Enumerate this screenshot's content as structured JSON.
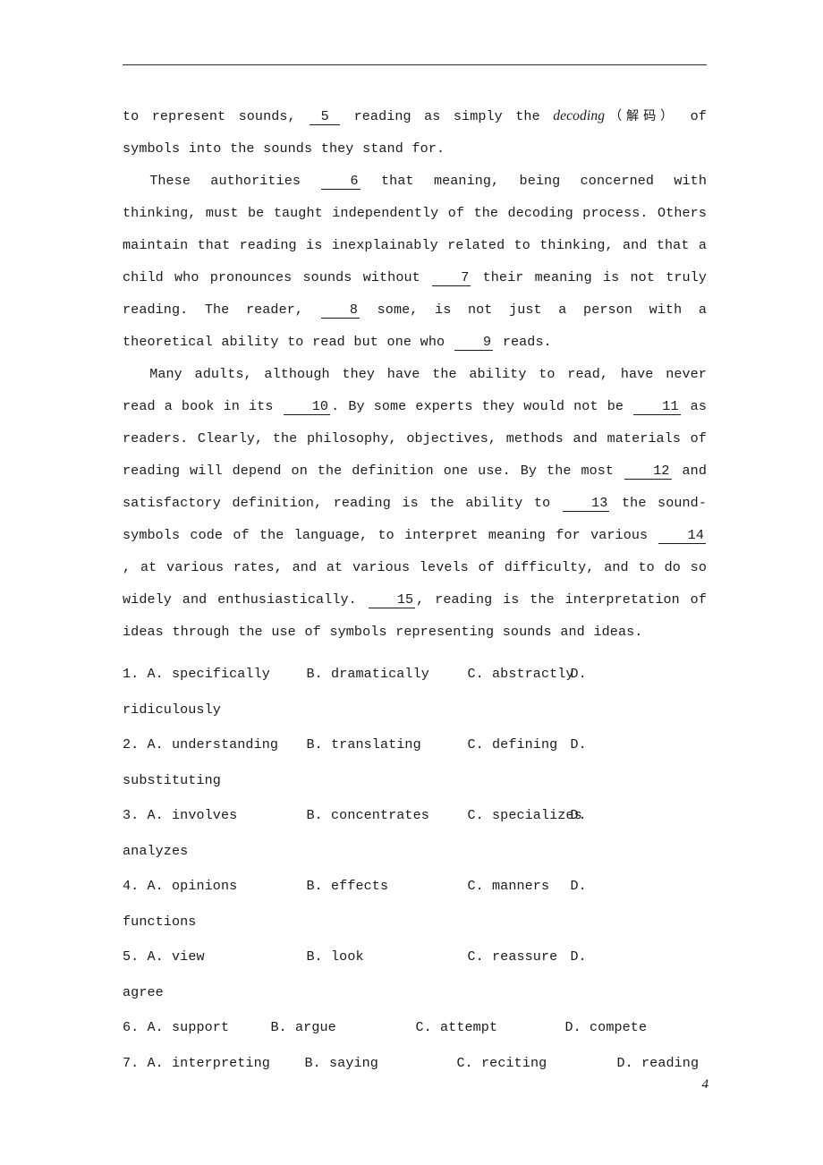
{
  "document": {
    "page_number": "4",
    "header_rule": true,
    "paragraphs": [
      {
        "id": "p-continued",
        "indent": false,
        "segments": [
          {
            "type": "text",
            "value": "to represent sounds, "
          },
          {
            "type": "blank",
            "value": "5"
          },
          {
            "type": "text",
            "value": " reading as simply the "
          },
          {
            "type": "italic",
            "value": "decoding"
          },
          {
            "type": "cjk",
            "value": "（解码）"
          },
          {
            "type": "text",
            "value": " of symbols into the sounds they stand for."
          }
        ]
      },
      {
        "id": "p-authorities",
        "indent": true,
        "segments": [
          {
            "type": "text",
            "value": "These authorities "
          },
          {
            "type": "blank",
            "value": "6"
          },
          {
            "type": "text",
            "value": " that meaning, being concerned with thinking, must be taught independently of the decoding process. Others maintain that reading is inexplainably related to thinking, and that a child who pronounces sounds without "
          },
          {
            "type": "blank",
            "value": "7"
          },
          {
            "type": "text",
            "value": " their meaning is not truly reading. The reader, "
          },
          {
            "type": "blank",
            "value": "8"
          },
          {
            "type": "text",
            "value": " some, is not just a person with a theoretical ability to read but one who "
          },
          {
            "type": "blank",
            "value": "9"
          },
          {
            "type": "text",
            "value": " reads."
          }
        ]
      },
      {
        "id": "p-many-adults",
        "indent": true,
        "segments": [
          {
            "type": "text",
            "value": "Many adults, although they have the ability to read, have never read a book in its "
          },
          {
            "type": "blank",
            "value": "10"
          },
          {
            "type": "text",
            "value": ". By some experts they would not be "
          },
          {
            "type": "blank",
            "value": "11"
          },
          {
            "type": "text",
            "value": " as readers. Clearly, the philosophy, objectives, methods and materials of reading will depend on the definition one use. By the most "
          },
          {
            "type": "blank",
            "value": "12"
          },
          {
            "type": "text",
            "value": " and satisfactory definition, reading is the ability to "
          },
          {
            "type": "blank",
            "value": "13"
          },
          {
            "type": "text",
            "value": " the sound-symbols code of the language, to interpret meaning for various "
          },
          {
            "type": "blank",
            "value": "14"
          },
          {
            "type": "text",
            "value": " , at various rates, and at various levels of difficulty, and to do so widely and enthusiastically. "
          },
          {
            "type": "blank",
            "value": "15"
          },
          {
            "type": "text",
            "value": ", reading is the interpretation of ideas through the use of symbols representing sounds and ideas."
          }
        ]
      }
    ],
    "question_options": [
      {
        "number": "1.",
        "layout": "wrap",
        "a_label": "A.",
        "a_text": "specifically",
        "b_label": "B.",
        "b_text": "dramatically",
        "c_label": "C.",
        "c_text": "abstractly",
        "d_label": "D.",
        "d_text": "ridiculously"
      },
      {
        "number": "2.",
        "layout": "wrap",
        "a_label": "A.",
        "a_text": "understanding",
        "b_label": "B.",
        "b_text": "translating",
        "c_label": "C.",
        "c_text": "defining",
        "d_label": "D.",
        "d_text": "substituting"
      },
      {
        "number": "3.",
        "layout": "wrap",
        "a_label": "A.",
        "a_text": "involves",
        "b_label": "B.",
        "b_text": "concentrates",
        "c_label": "C.",
        "c_text": "specializes",
        "d_label": "D.",
        "d_text": "analyzes"
      },
      {
        "number": "4.",
        "layout": "wrap",
        "a_label": "A.",
        "a_text": "opinions",
        "b_label": "B.",
        "b_text": "effects",
        "c_label": "C.",
        "c_text": "manners",
        "d_label": "D.",
        "d_text": "functions"
      },
      {
        "number": "5.",
        "layout": "wrap",
        "a_label": "A.",
        "a_text": "view",
        "b_label": "B.",
        "b_text": "look",
        "c_label": "C.",
        "c_text": "reassure",
        "d_label": "D.",
        "d_text": "agree"
      },
      {
        "number": "6.",
        "layout": "six",
        "a_label": "A.",
        "a_text": "support",
        "b_label": "B.",
        "b_text": "argue",
        "c_label": "C.",
        "c_text": "attempt",
        "d_label": "D.",
        "d_text": "compete"
      },
      {
        "number": "7.",
        "layout": "seven",
        "a_label": "A.",
        "a_text": "interpreting",
        "b_label": "B.",
        "b_text": "saying",
        "c_label": "C.",
        "c_text": "reciting",
        "d_label": "D.",
        "d_text": "reading"
      }
    ]
  }
}
